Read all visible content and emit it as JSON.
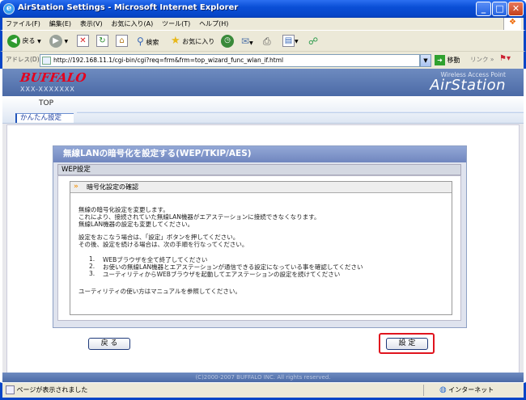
{
  "window": {
    "title": "AirStation Settings - Microsoft Internet Explorer",
    "minimize": "_",
    "maximize": "□",
    "close": "✕"
  },
  "menu": [
    "ファイル(F)",
    "編集(E)",
    "表示(V)",
    "お気に入り(A)",
    "ツール(T)",
    "ヘルプ(H)"
  ],
  "toolbar": {
    "back": "戻る",
    "search": "検索",
    "favorites": "お気に入り"
  },
  "address": {
    "label": "アドレス(D)",
    "url": "http://192.168.11.1/cgi-bin/cgi?req=frm&frm=top_wizard_func_wlan_if.html",
    "go": "移動",
    "links": "リンク"
  },
  "header": {
    "logo": "BUFFALO",
    "model": "XXX-XXXXXXX",
    "tagline": "Wireless Access Point",
    "product": "AirStation"
  },
  "nav": {
    "top_tab": "TOP",
    "sub_tab": "かんたん設定"
  },
  "dialog": {
    "title": "無線LANの暗号化を設定する(WEP/TKIP/AES)",
    "section": "WEP設定",
    "box_title": "暗号化設定の確認",
    "lines": [
      "無線の暗号化設定を変更します。",
      "これにより、接続されていた無線LAN機器がエアステーションに接続できなくなります。",
      "無線LAN機器の設定も変更してください。",
      "設定をおこなう場合は、「設定」ボタンを押してください。",
      "その後、設定を続ける場合は、次の手順を行なってください。"
    ],
    "steps": [
      {
        "num": "1.",
        "text": "WEBブラウザを全て終了してください"
      },
      {
        "num": "2.",
        "text": "お使いの無線LAN機器とエアステーションが通信できる設定になっている事を確認してください"
      },
      {
        "num": "3.",
        "text": "ユーティリティからWEBブラウザを起動してエアステーションの設定を続けてください"
      }
    ],
    "footnote": "ユーティリティの使い方はマニュアルを参照してください。"
  },
  "buttons": {
    "back": "戻 る",
    "set": "設 定"
  },
  "footer": "(C)2000-2007 BUFFALO INC. All rights reserved.",
  "status": {
    "text": "ページが表示されました",
    "zone": "インターネット"
  }
}
